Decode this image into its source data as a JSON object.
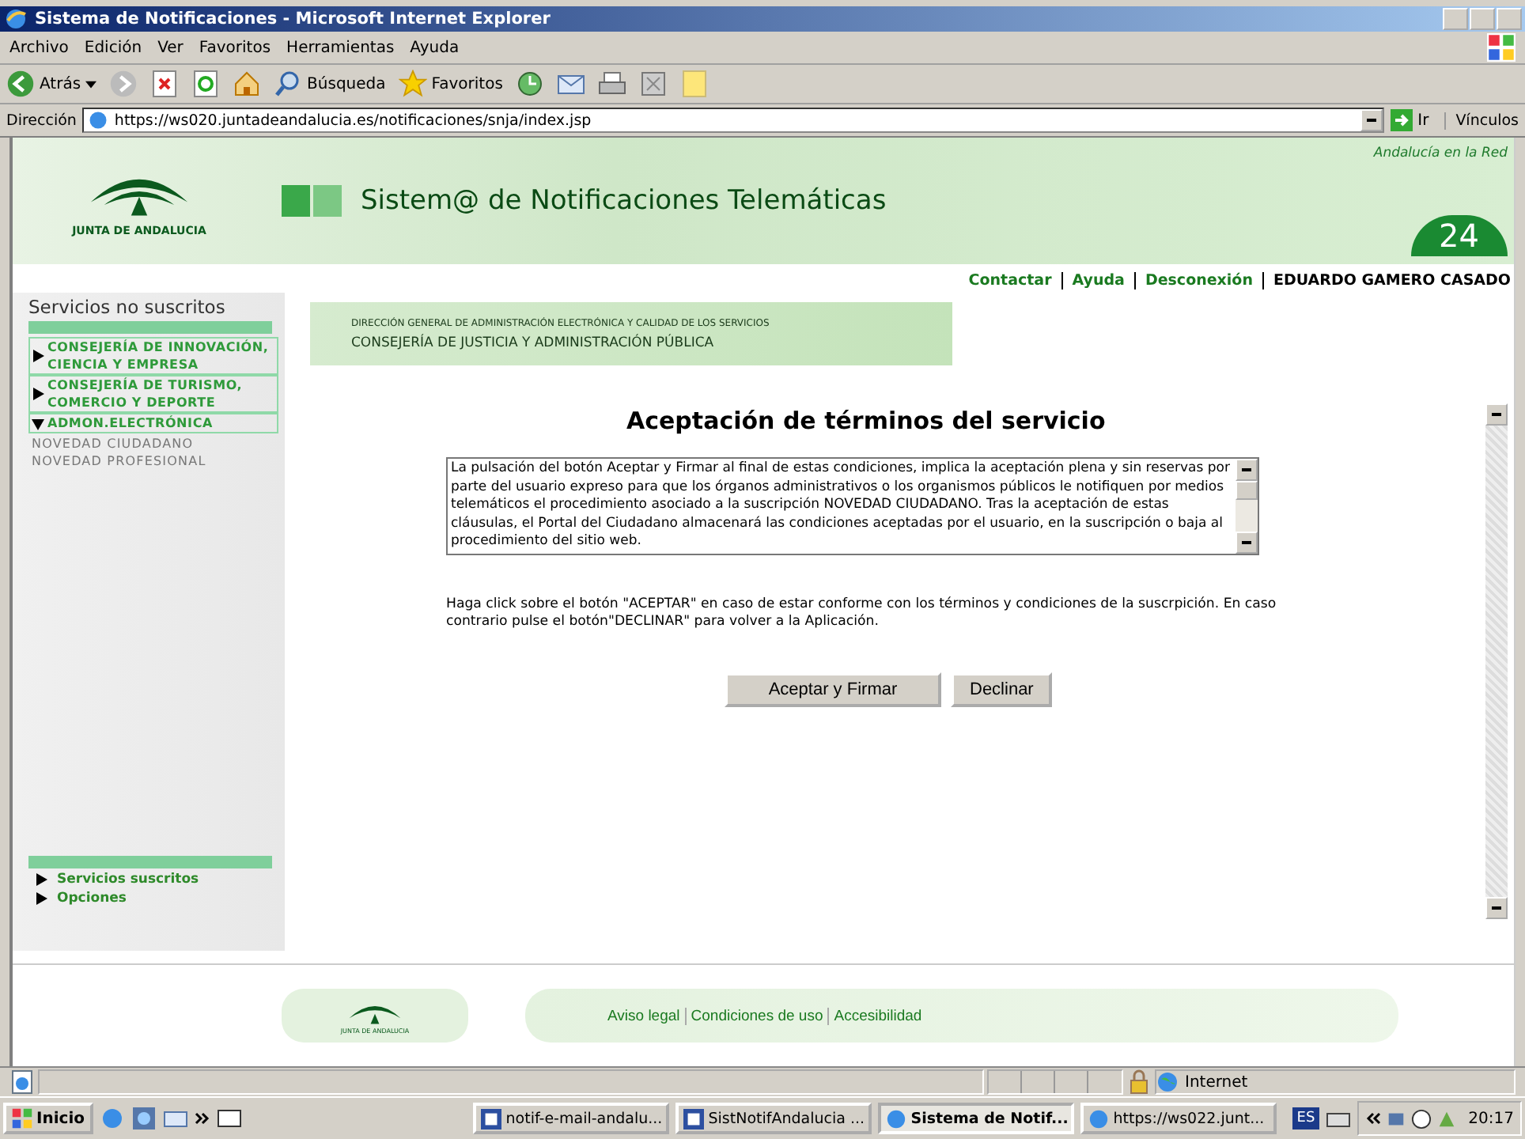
{
  "window": {
    "title": "Sistema de Notificaciones - Microsoft Internet Explorer"
  },
  "menu": [
    "Archivo",
    "Edición",
    "Ver",
    "Favoritos",
    "Herramientas",
    "Ayuda"
  ],
  "toolbar": {
    "back": "Atrás",
    "search": "Búsqueda",
    "favorites": "Favoritos"
  },
  "address_bar": {
    "label": "Dirección",
    "url": "https://ws020.juntadeandalucia.es/notificaciones/snja/index.jsp",
    "go": "Ir",
    "links": "Vínculos"
  },
  "header": {
    "logo_text": "JUNTA DE ANDALUCIA",
    "title": "Sistem@ de Notificaciones Telemáticas",
    "badge_caption": "Andalucía en la Red",
    "badge_number": "24"
  },
  "top_links": [
    "Contactar",
    "Ayuda",
    "Desconexión"
  ],
  "user": "EDUARDO GAMERO CASADO",
  "sidebar": {
    "heading": "Servicios no suscritos",
    "items": [
      {
        "label": "CONSEJERÍA DE INNOVACIÓN, CIENCIA Y EMPRESA",
        "expanded": false
      },
      {
        "label": "CONSEJERÍA DE TURISMO, COMERCIO Y DEPORTE",
        "expanded": false
      },
      {
        "label": "ADMON.ELECTRÓNICA",
        "expanded": true,
        "children": [
          "NOVEDAD CIUDADANO",
          "NOVEDAD PROFESIONAL"
        ]
      }
    ],
    "bottom_items": [
      "Servicios suscritos",
      "Opciones"
    ]
  },
  "banner": {
    "line_1": "DIRECCIÓN GENERAL DE ADMINISTRACIÓN ELECTRÓNICA Y CALIDAD DE LOS SERVICIOS",
    "line_2": "CONSEJERÍA DE JUSTICIA Y ADMINISTRACIÓN PÚBLICA"
  },
  "main": {
    "heading": "Aceptación de términos del servicio",
    "terms": "La pulsación del botón Aceptar y Firmar al final de estas condiciones, implica la aceptación plena y sin reservas por parte del usuario expreso para que los órganos administrativos o los organismos públicos le notifiquen por medios telemáticos el procedimiento asociado a la suscripción NOVEDAD CIUDADANO. Tras la aceptación de estas cláusulas, el Portal del Ciudadano almacenará las condiciones aceptadas por el usuario, en la suscripción o baja al procedimiento del sitio web.",
    "instructions": "Haga click sobre el botón \"ACEPTAR\" en caso de estar conforme con los términos y condiciones de la suscrpición. En caso contrario pulse el botón\"DECLINAR\" para volver a la Aplicación.",
    "buttons": [
      "Aceptar y Firmar",
      "Declinar"
    ]
  },
  "footer": {
    "logo_text": "JUNTA DE ANDALUCIA",
    "links": [
      "Aviso legal",
      "Condiciones de uso",
      "Accesibilidad"
    ]
  },
  "status_bar": {
    "zone": "Internet"
  },
  "taskbar": {
    "start": "Inicio",
    "tasks": [
      {
        "label": "notif-e-mail-andalu...",
        "kind": "word",
        "selected": false
      },
      {
        "label": "SistNotifAndalucia ...",
        "kind": "word",
        "selected": false
      },
      {
        "label": "Sistema de Notif...",
        "kind": "browser",
        "selected": true
      },
      {
        "label": "https://ws022.junt...",
        "kind": "browser",
        "selected": false
      }
    ],
    "language": "ES",
    "clock": "20:17"
  }
}
